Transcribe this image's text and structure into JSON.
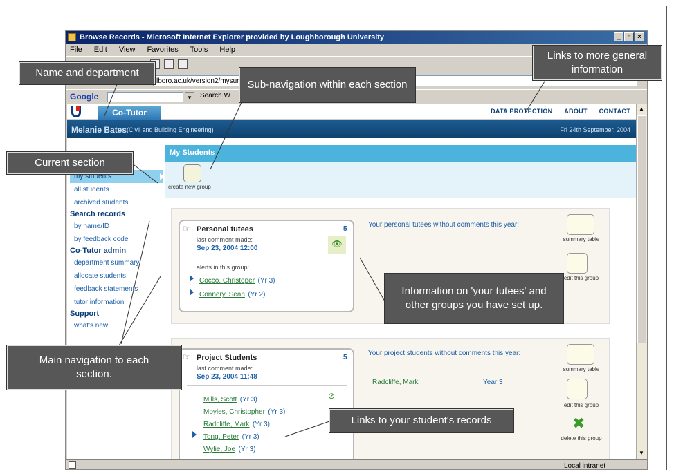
{
  "browser": {
    "title": "Browse Records - Microsoft Internet Explorer provided by Loughborough University",
    "menu": [
      "File",
      "Edit",
      "View",
      "Favorites",
      "Tools",
      "Help"
    ],
    "address": "lboro.ac.uk/version2/mysumma",
    "google_label": "Google",
    "search_web": "Search W",
    "status_zone": "Local intranet"
  },
  "site": {
    "tab": "Co-Tutor",
    "top_links": [
      "DATA PROTECTION",
      "ABOUT",
      "CONTACT"
    ],
    "user_name": "Melanie Bates",
    "department": "(Civil and Building Engineering)",
    "date": "Fri 24th September, 2004"
  },
  "nav": {
    "items_my": [
      "my students",
      "all students",
      "archived students"
    ],
    "search_head": "Search records",
    "search_items": [
      "by name/ID",
      "by feedback code"
    ],
    "admin_head": "Co-Tutor admin",
    "admin_items": [
      "department summary",
      "allocate students",
      "feedback statements",
      "tutor information"
    ],
    "support_head": "Support",
    "support_items": [
      "what's new"
    ]
  },
  "main": {
    "section_title": "My Students",
    "create_group": "create new group"
  },
  "group1": {
    "title": "Personal tutees",
    "count": "5",
    "last_comment_label": "last comment made:",
    "last_comment_date": "Sep 23, 2004 12:00",
    "alerts_label": "alerts in this group:",
    "students": [
      {
        "name": "Cocco, Christoper",
        "year": "(Yr 3)"
      },
      {
        "name": "Connery, Sean",
        "year": "(Yr 2)"
      }
    ],
    "no_comments_text": "Your personal tutees without comments this year:",
    "actions": [
      "summary table",
      "edit this group"
    ]
  },
  "group2": {
    "title": "Project Students",
    "count": "5",
    "last_comment_label": "last comment made:",
    "last_comment_date": "Sep 23, 2004 11:48",
    "students": [
      {
        "name": "Mills, Scott",
        "year": "(Yr 3)"
      },
      {
        "name": "Moyles, Christopher",
        "year": "(Yr 3)"
      },
      {
        "name": "Radcliffe, Mark",
        "year": "(Yr 3)"
      },
      {
        "name": "Tong, Peter",
        "year": "(Yr 3)"
      },
      {
        "name": "Wylie, Joe",
        "year": "(Yr 3)"
      }
    ],
    "no_comments_text": "Your project students without comments this year:",
    "no_comment_student": "Radcliffe, Mark",
    "no_comment_year": "Year 3",
    "actions": [
      "summary table",
      "edit this group",
      "delete this group"
    ]
  },
  "callouts": {
    "name_dept": "Name and department",
    "subnav": "Sub-navigation within each section",
    "general": "Links to more general information",
    "current": "Current section",
    "tutees": "Information on 'your tutees' and other groups you have set up.",
    "mainnav": "Main navigation to each section.",
    "records": "Links to your student's records"
  },
  "colors": {
    "callout_bg": "#575757",
    "site_blue": "#0e426f",
    "section_bar": "#4bb3dc"
  }
}
